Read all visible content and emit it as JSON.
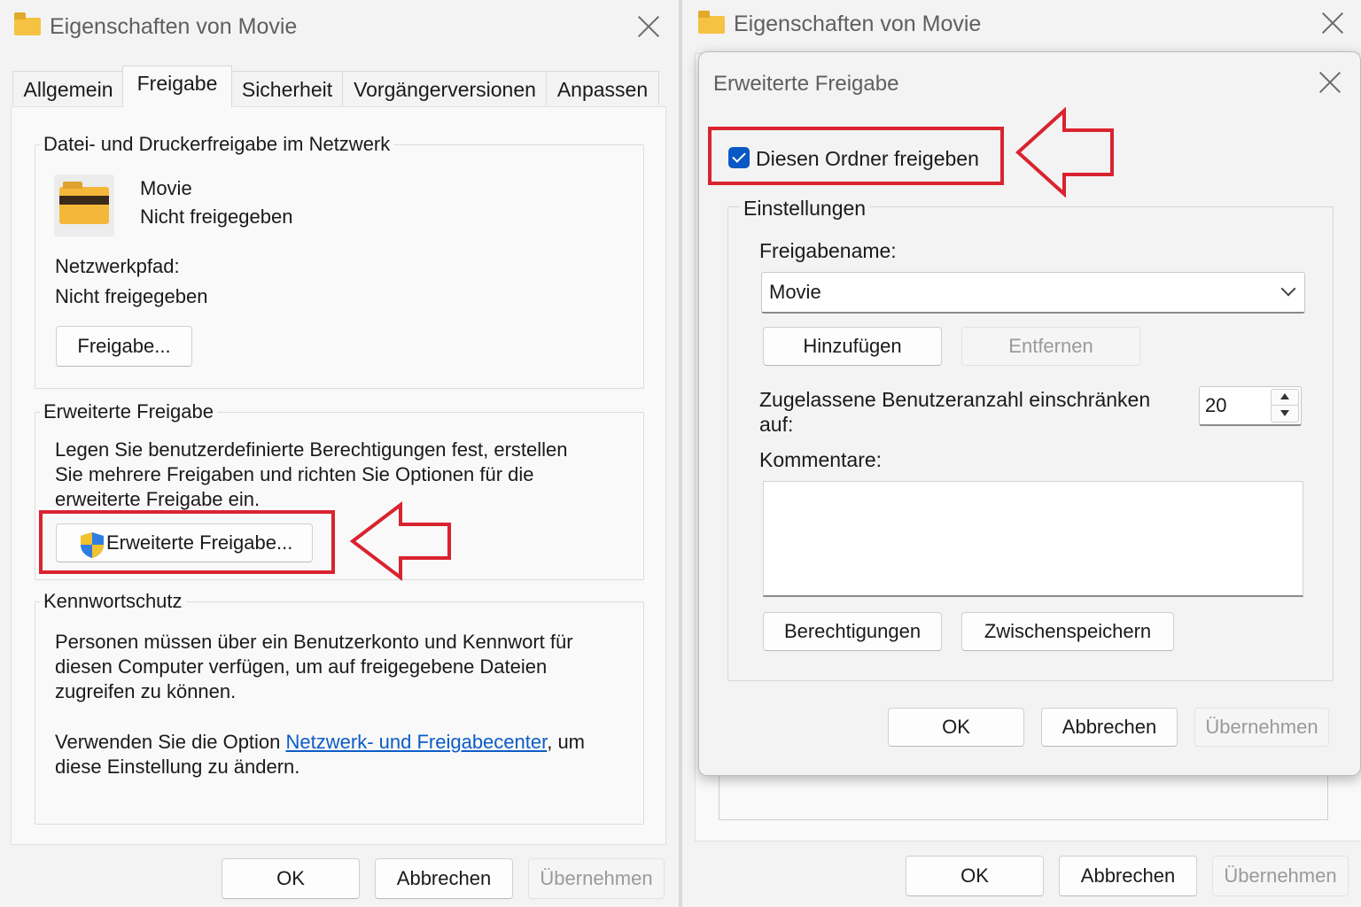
{
  "left_window": {
    "title": "Eigenschaften von Movie",
    "tabs": [
      "Allgemein",
      "Freigabe",
      "Sicherheit",
      "Vorgängerversionen",
      "Anpassen"
    ],
    "active_tab": "Freigabe",
    "network_sharing": {
      "title": "Datei- und Druckerfreigabe im Netzwerk",
      "folder_name": "Movie",
      "folder_status": "Nicht freigegeben",
      "path_label": "Netzwerkpfad:",
      "path_value": "Nicht freigegeben",
      "share_button": "Freigabe..."
    },
    "advanced_sharing": {
      "title": "Erweiterte Freigabe",
      "description_lines": [
        "Legen Sie benutzerdefinierte Berechtigungen fest, erstellen",
        "Sie mehrere Freigaben und richten Sie Optionen für die",
        "erweiterte Freigabe ein."
      ],
      "button": "Erweiterte Freigabe..."
    },
    "password_protection": {
      "title": "Kennwortschutz",
      "description_lines": [
        "Personen müssen über ein Benutzerkonto und Kennwort für",
        "diesen Computer verfügen, um auf freigegebene Dateien",
        "zugreifen zu können."
      ],
      "option_prefix": "Verwenden Sie die Option ",
      "option_link": "Netzwerk- und Freigabecenter",
      "option_suffix": ", um",
      "option_line2": "diese Einstellung zu ändern."
    },
    "buttons": {
      "ok": "OK",
      "cancel": "Abbrechen",
      "apply": "Übernehmen"
    }
  },
  "right_window": {
    "title": "Eigenschaften von Movie",
    "buttons": {
      "ok": "OK",
      "cancel": "Abbrechen",
      "apply": "Übernehmen"
    },
    "dialog": {
      "title": "Erweiterte Freigabe",
      "share_checkbox_label": "Diesen Ordner freigeben",
      "share_checked": true,
      "settings_title": "Einstellungen",
      "share_name_label": "Freigabename:",
      "share_name_value": "Movie",
      "add_button": "Hinzufügen",
      "remove_button": "Entfernen",
      "limit_label_line1": "Zugelassene Benutzeranzahl einschränken",
      "limit_label_line2": "auf:",
      "limit_value": "20",
      "comments_label": "Kommentare:",
      "comments_value": "",
      "permissions_button": "Berechtigungen",
      "caching_button": "Zwischenspeichern",
      "ok": "OK",
      "cancel": "Abbrechen",
      "apply": "Übernehmen"
    }
  },
  "colors": {
    "highlight": "#d9232f",
    "accent": "#0a58c5",
    "link": "#0b5cc7"
  }
}
